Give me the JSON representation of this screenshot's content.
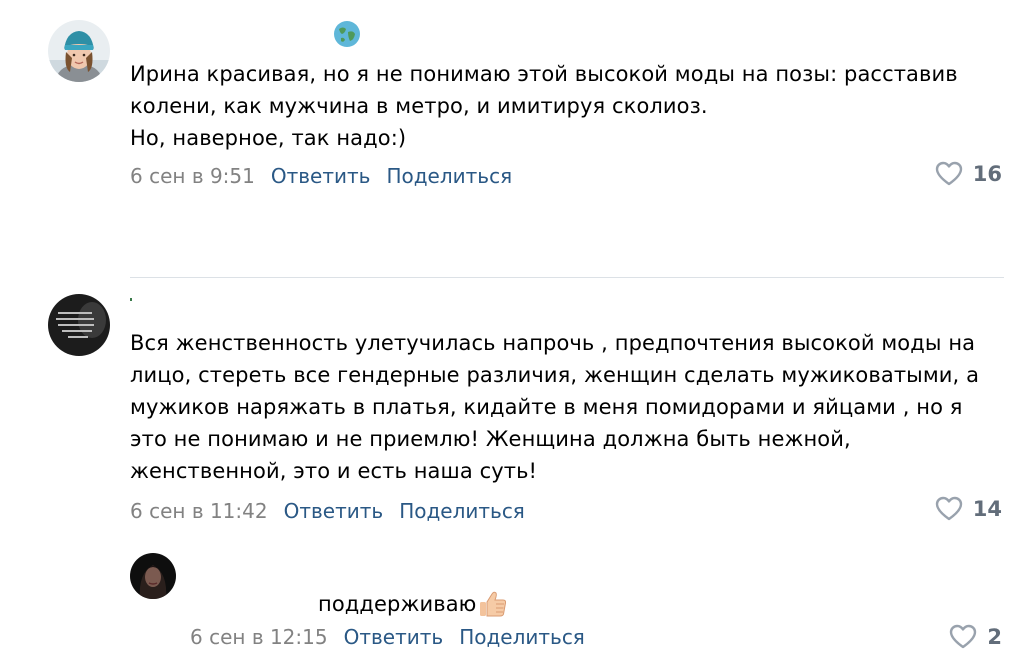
{
  "comments": [
    {
      "avatar_icon": "user-avatar-woman-blue-hat",
      "badge_icon": "globe-icon",
      "lines": [
        "Ирина красивая, но я не понимаю этой высокой моды на позы: расставив",
        "колени, как мужчина в метро, и имитируя сколиоз.",
        "Но, наверное, так надо:)"
      ],
      "date": "6 сен в 9:51",
      "reply_label": "Ответить",
      "share_label": "Поделиться",
      "likes": "16"
    },
    {
      "avatar_icon": "user-avatar-dark-quote",
      "lines": [
        "Вся женственность улетучилась напрочь , предпочтения высокой моды на",
        "лицо, стереть все гендерные различия, женщин сделать мужиковатыми, а",
        "мужиков наряжать в платья, кидайте в меня помидорами и яйцами , но я",
        "это не понимаю и не приемлю! Женщина должна быть нежной,",
        "женственной, это и есть наша суть!"
      ],
      "date": "6 сен в 11:42",
      "reply_label": "Ответить",
      "share_label": "Поделиться",
      "likes": "14"
    },
    {
      "avatar_icon": "user-avatar-dark-portrait",
      "lines": [
        "поддерживаю"
      ],
      "emoji_icon": "thumbs-up-emoji",
      "date": "6 сен в 12:15",
      "reply_label": "Ответить",
      "share_label": "Поделиться",
      "likes": "2"
    }
  ],
  "colors": {
    "link": "#2a5885",
    "date": "#828282",
    "like_count": "#626d7a",
    "divider": "#dce1e6"
  }
}
